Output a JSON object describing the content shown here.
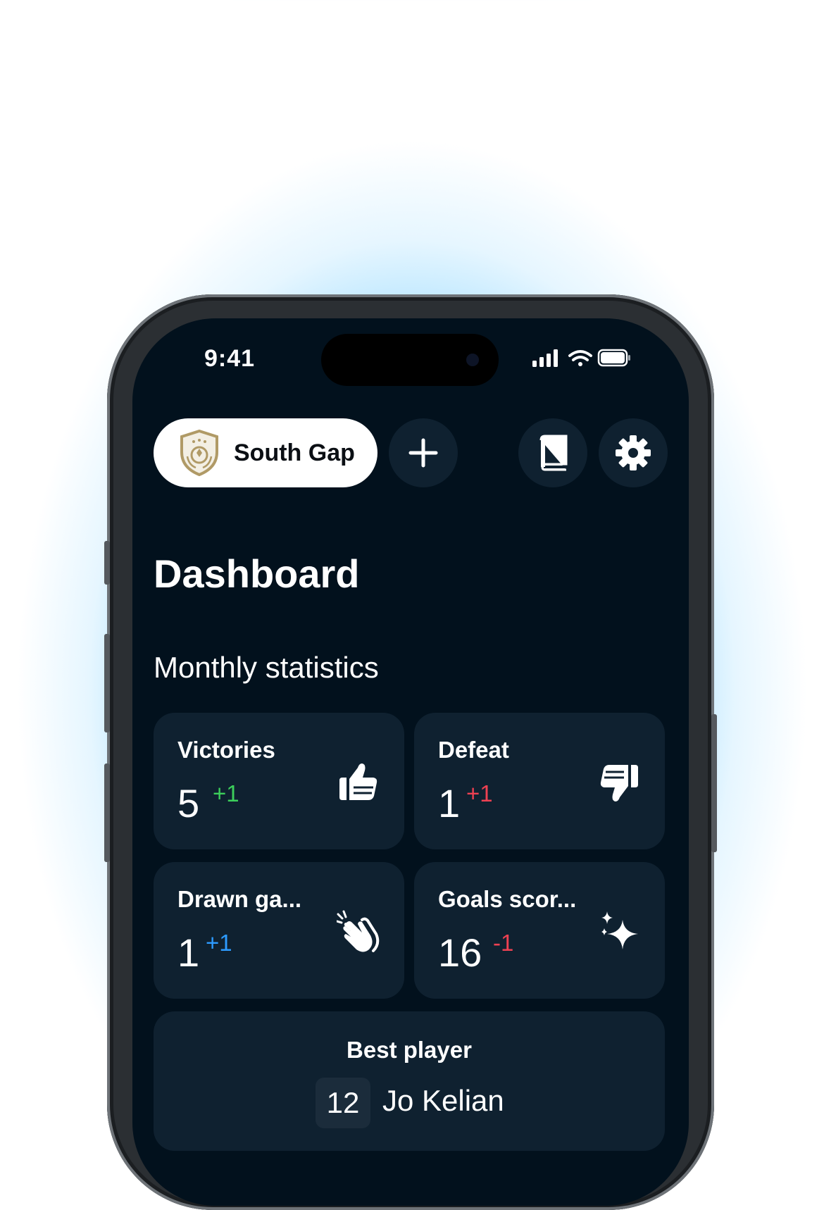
{
  "status_bar": {
    "time": "9:41",
    "icons": [
      "signal-icon",
      "wifi-icon",
      "battery-icon"
    ]
  },
  "header": {
    "club_name": "South Gap",
    "add_icon": "plus-icon",
    "book_icon": "book-icon",
    "settings_icon": "gear-icon"
  },
  "page": {
    "title": "Dashboard",
    "section_title": "Monthly statistics"
  },
  "stats": [
    {
      "label": "Victories",
      "value": "5",
      "delta": "+1",
      "delta_color": "#3ccf5b",
      "icon": "thumbs-up-icon"
    },
    {
      "label": "Defeat",
      "value": "1",
      "delta": "+1",
      "delta_color": "#ee4152",
      "icon": "thumbs-down-icon"
    },
    {
      "label": "Drawn ga...",
      "value": "1",
      "delta": "+1",
      "delta_color": "#2d9bff",
      "icon": "clapping-hands-icon"
    },
    {
      "label": "Goals scor...",
      "value": "16",
      "delta": "-1",
      "delta_color": "#ee4152",
      "icon": "sparkles-icon"
    }
  ],
  "best_player": {
    "label": "Best player",
    "number": "12",
    "name": "Jo Kelian"
  },
  "colors": {
    "screen_bg": "#02111d",
    "card_bg": "#0f2130",
    "glow": "#2fb2ff"
  }
}
